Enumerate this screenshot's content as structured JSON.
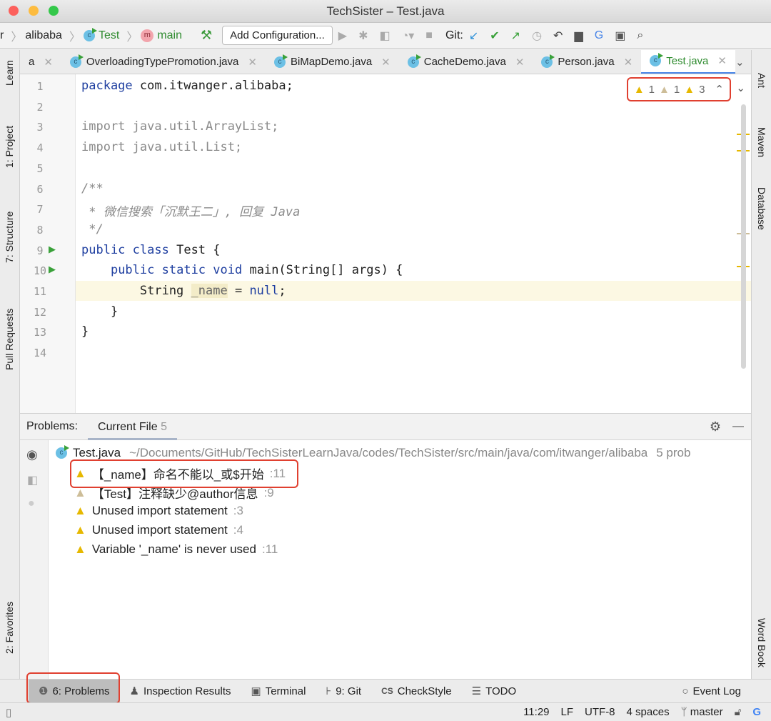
{
  "window": {
    "title": "TechSister – Test.java"
  },
  "breadcrumb": [
    "r",
    "alibaba",
    "Test",
    "main"
  ],
  "toolbar": {
    "add_configuration": "Add Configuration...",
    "git_label": "Git:"
  },
  "tabs": [
    {
      "label": "a"
    },
    {
      "label": "OverloadingTypePromotion.java"
    },
    {
      "label": "BiMapDemo.java"
    },
    {
      "label": "CacheDemo.java"
    },
    {
      "label": "Person.java"
    },
    {
      "label": "Test.java",
      "active": true
    }
  ],
  "left_tools": [
    "Learn",
    "1: Project",
    "7: Structure",
    "Pull Requests",
    "2: Favorites"
  ],
  "right_tools": [
    "Ant",
    "Maven",
    "Database",
    "Word Book"
  ],
  "inspection": {
    "error_count": "1",
    "weak_count": "1",
    "warning_count": "3"
  },
  "code_lines": [
    {
      "n": "1",
      "text": "package com.itwanger.alibaba;"
    },
    {
      "n": "2",
      "text": ""
    },
    {
      "n": "3",
      "text": "import java.util.ArrayList;"
    },
    {
      "n": "4",
      "text": "import java.util.List;"
    },
    {
      "n": "5",
      "text": ""
    },
    {
      "n": "6",
      "text": "/**"
    },
    {
      "n": "7",
      "text": " * 微信搜索「沉默王二」, 回复 Java"
    },
    {
      "n": "8",
      "text": " */"
    },
    {
      "n": "9",
      "text": "public class Test {"
    },
    {
      "n": "10",
      "text": "    public static void main(String[] args) {"
    },
    {
      "n": "11",
      "text": "        String _name = null;"
    },
    {
      "n": "12",
      "text": "    }"
    },
    {
      "n": "13",
      "text": "}"
    },
    {
      "n": "14",
      "text": ""
    }
  ],
  "problems": {
    "label": "Problems:",
    "tab": "Current File",
    "tab_count": "5",
    "file": {
      "name": "Test.java",
      "path": "~/Documents/GitHub/TechSisterLearnJava/codes/TechSister/src/main/java/com/itwanger/alibaba",
      "count": "5 prob"
    },
    "items": [
      {
        "text": "【_name】命名不能以_或$开始",
        "line": ":11"
      },
      {
        "text": "【Test】注释缺少@author信息",
        "line": ":9"
      },
      {
        "text": "Unused import statement",
        "line": ":3"
      },
      {
        "text": "Unused import statement",
        "line": ":4"
      },
      {
        "text": "Variable '_name' is never used",
        "line": ":11"
      }
    ]
  },
  "tool_windows": [
    "6: Problems",
    "Inspection Results",
    "Terminal",
    "9: Git",
    "CheckStyle",
    "TODO",
    "Event Log"
  ],
  "status": {
    "position": "11:29",
    "line_sep": "LF",
    "encoding": "UTF-8",
    "indent": "4 spaces",
    "branch": "master"
  },
  "colors": {
    "warning": "#e6b800",
    "highlight_box": "#e04030",
    "active_tab": "#2e8b2e"
  }
}
